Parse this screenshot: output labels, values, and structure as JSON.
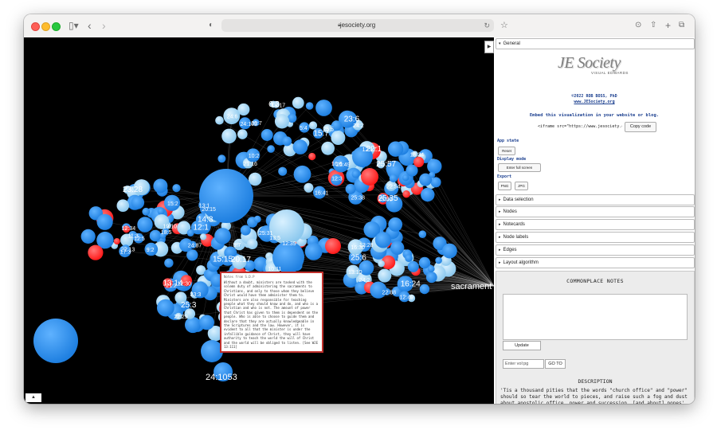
{
  "browser": {
    "url": "jesociety.org",
    "icons": {
      "sidebar": "sidebar-icon",
      "back": "chevron-left-icon",
      "forward": "chevron-right-icon",
      "shield": "shield-icon",
      "lock": "lock-icon",
      "reload": "reload-icon",
      "bookmark": "star-icon",
      "download": "download-icon",
      "share": "share-icon",
      "newtab": "plus-icon",
      "tabs": "tabs-icon"
    }
  },
  "graph": {
    "node_color_default": "#1e7fe0",
    "node_color_light": "#8cc8ee",
    "node_color_highlight": "#ff1a1a",
    "labels": [
      "22:1",
      "24:2",
      "21:16",
      "16:6",
      "15:7",
      "12:3",
      "24:6",
      "20:7",
      "12:1",
      "11:3",
      "12:5",
      "13:1",
      "14:3",
      "15:2",
      "18:5",
      "22:13",
      "25:3",
      "21:2",
      "23:3",
      "12:30",
      "13:14",
      "13:18",
      "22:29",
      "23:37",
      "25:57",
      "25:30",
      "25:38",
      "25:49",
      "25:35",
      "22:54",
      "16:34",
      "12:17",
      "25:6",
      "22:88",
      "24:2",
      "13:10",
      "16:24",
      "12:49",
      "13:28",
      "16:30",
      "15:15",
      "24:87",
      "12:39",
      "25:31",
      "20:17",
      "13:5",
      "9:7",
      "10:11",
      "12:13",
      "5:4",
      "18:17",
      "24:105",
      "23:6",
      "16:41",
      "25:5",
      "10:2",
      "6:3",
      "12:34",
      "17:3",
      "20:15",
      "23:28",
      "9:2",
      "19:10",
      "sacrament",
      "24:1053"
    ]
  },
  "notecard": {
    "title": "Notes from S.D.P",
    "text": "Without a doubt, ministers are tasked with the solemn duty of administering the sacraments to Christians, and only to those whom they believe Christ would have them administer them to. Ministers are also responsible for teaching people what they should know and do, and who is a Christian and who is not. The amount of power that Christ has given to them is dependent on the people. Who is able to choose to guide them and declare that they are actually knowledgeable in the Scriptures and the law. However, it is evident to all that the minister is under the infallible guidance of Christ, they will have authority to teach the world the will of Christ and the world will be obliged to listen. [See WJE 13:111]"
  },
  "panel": {
    "sections": [
      "General",
      "Data selection",
      "Nodes",
      "Notecards",
      "Node labels",
      "Edges",
      "Layout algorithm"
    ],
    "logo": "JE Society",
    "logo_sub": "VISUAL EDWARDS",
    "copyright_line": "©2022 ROB BOSS, PhD",
    "site_line": "www.JESociety.org",
    "embed_text": "Embed this visualization in your website or blog.",
    "iframe_code": "<iframe src=\"https://www.jesociety.org/",
    "copy_label": "Copy code",
    "app_state_label": "App state",
    "reset_label": "Reset",
    "display_mode_label": "Display mode",
    "fullscreen_label": "Enter full screen",
    "export_label": "Export",
    "png_label": "PNG",
    "jpg_label": "JPG",
    "notes_title": "COMMONPLACE NOTES",
    "update_label": "Update",
    "vol_placeholder": "Enter vol:pg",
    "goto_label": "GO TO",
    "desc_title": "DESCRIPTION",
    "desc_text": "'Tis a thousand pities that the words \"church office\" and \"power\" should so tear the world to pieces, and raise such a fog and dust about apostolic office, power and succession, [and about] popes', bishops' and presbyters' power. It is not such a desperately difficult thing to know what we have to go by, if the matter be rightly"
  }
}
